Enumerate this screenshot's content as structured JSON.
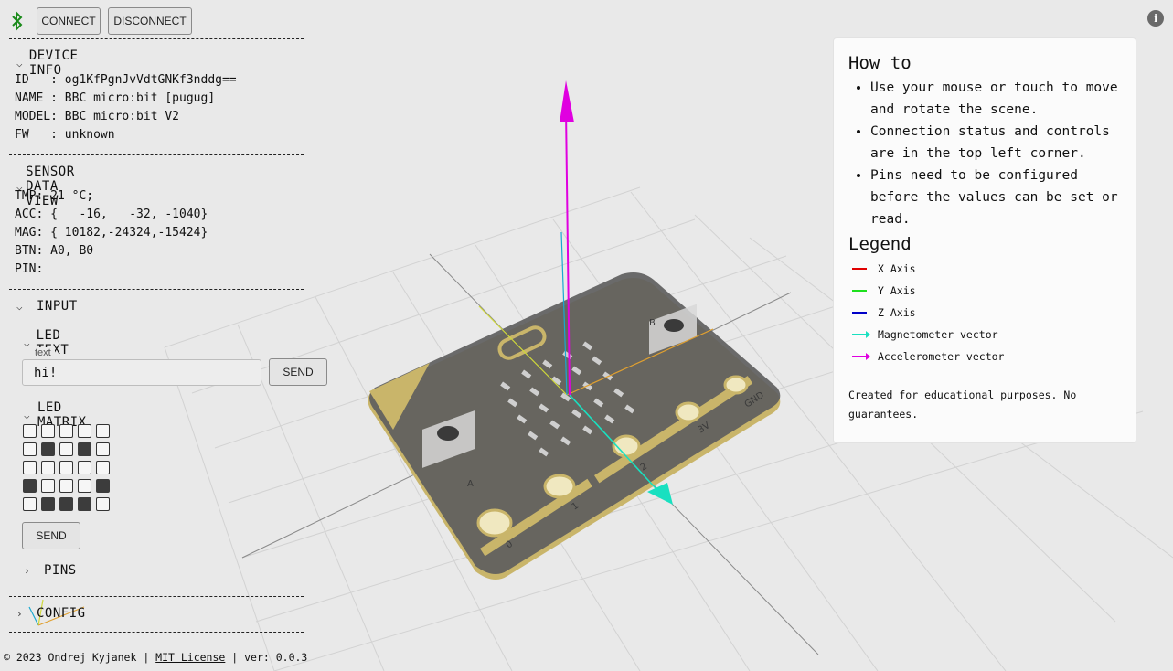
{
  "toolbar": {
    "connect_label": "CONNECT",
    "disconnect_label": "DISCONNECT",
    "bluetooth_icon": "bluetooth-icon",
    "info_icon": "info-icon",
    "info_glyph": "i"
  },
  "device_info": {
    "title": "DEVICE INFO",
    "rows": [
      "ID   : og1KfPgnJvVdtGNKf3nddg==",
      "NAME : BBC micro:bit [pugug]",
      "MODEL: BBC micro:bit V2",
      "FW   : unknown"
    ]
  },
  "sensor_data": {
    "title": "SENSOR DATA VIEW",
    "rows": [
      "TMP: 21 °C;",
      "ACC: {   -16,   -32, -1040}",
      "MAG: { 10182,-24324,-15424}",
      "BTN: A0, B0",
      "PIN:"
    ]
  },
  "input": {
    "title": "INPUT",
    "led_text": {
      "title": "LED TEXT",
      "field_label": "text",
      "value": "hi!",
      "send_label": "SEND"
    },
    "led_matrix": {
      "title": "LED MATRIX",
      "grid": [
        [
          0,
          0,
          0,
          0,
          0
        ],
        [
          0,
          1,
          0,
          1,
          0
        ],
        [
          0,
          0,
          0,
          0,
          0
        ],
        [
          1,
          0,
          0,
          0,
          1
        ],
        [
          0,
          1,
          1,
          1,
          0
        ]
      ],
      "send_label": "SEND"
    },
    "pins_title": "PINS"
  },
  "config": {
    "title": "CONFIG"
  },
  "how_to": {
    "title": "How to",
    "items": [
      "Use your mouse or touch to move and rotate the scene.",
      "Connection status and controls are in the top left corner.",
      "Pins need to be configured before the values can be set or read."
    ],
    "legend_title": "Legend",
    "legend": [
      {
        "label": "X Axis",
        "color": "#e00000",
        "kind": "line"
      },
      {
        "label": "Y Axis",
        "color": "#1ee01e",
        "kind": "line"
      },
      {
        "label": "Z Axis",
        "color": "#0000c8",
        "kind": "line"
      },
      {
        "label": "Magnetometer vector",
        "color": "#19e0c0",
        "kind": "arrow"
      },
      {
        "label": "Accelerometer vector",
        "color": "#e000e0",
        "kind": "arrow"
      }
    ],
    "note": "Created for educational purposes. No guarantees."
  },
  "footer": {
    "copyright": "© 2023 Ondrej Kyjanek | ",
    "license_link": "MIT License",
    "version": " | ver: 0.0.3"
  },
  "board": {
    "pin_labels": [
      "0",
      "1",
      "2",
      "3V",
      "GND"
    ],
    "button_labels": [
      "A",
      "B"
    ]
  }
}
